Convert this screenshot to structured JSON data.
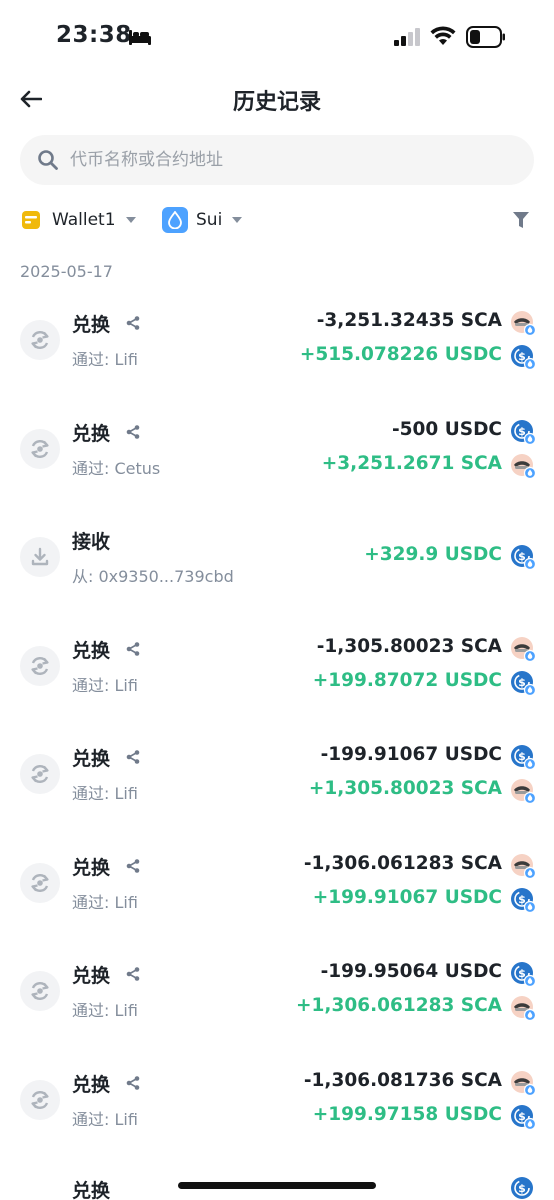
{
  "status_bar": {
    "time": "23:38"
  },
  "nav": {
    "title": "历史记录"
  },
  "search": {
    "placeholder": "代币名称或合约地址"
  },
  "filters": {
    "wallet": "Wallet1",
    "chain": "Sui"
  },
  "colors": {
    "positive": "#2ebd85",
    "negative": "#1e2329",
    "muted": "#848e9c",
    "wallet_yellow": "#f0b90b",
    "sui_blue": "#4da2ff",
    "usdc_blue": "#2775ca"
  },
  "date": "2025-05-17",
  "transactions": [
    {
      "type": "兑换",
      "sub": "通过: Lifi",
      "line1": "-3,251.32435 SCA",
      "line1_token": "SCA",
      "line2": "+515.078226 USDC",
      "line2_token": "USDC"
    },
    {
      "type": "兑换",
      "sub": "通过: Cetus",
      "line1": "-500 USDC",
      "line1_token": "USDC",
      "line2": "+3,251.2671 SCA",
      "line2_token": "SCA"
    },
    {
      "type": "接收",
      "sub": "从: 0x9350...739cbd",
      "line1": "+329.9 USDC",
      "line1_token": "USDC"
    },
    {
      "type": "兑换",
      "sub": "通过: Lifi",
      "line1": "-1,305.80023 SCA",
      "line1_token": "SCA",
      "line2": "+199.87072 USDC",
      "line2_token": "USDC"
    },
    {
      "type": "兑换",
      "sub": "通过: Lifi",
      "line1": "-199.91067 USDC",
      "line1_token": "USDC",
      "line2": "+1,305.80023 SCA",
      "line2_token": "SCA"
    },
    {
      "type": "兑换",
      "sub": "通过: Lifi",
      "line1": "-1,306.061283 SCA",
      "line1_token": "SCA",
      "line2": "+199.91067 USDC",
      "line2_token": "USDC"
    },
    {
      "type": "兑换",
      "sub": "通过: Lifi",
      "line1": "-199.95064 USDC",
      "line1_token": "USDC",
      "line2": "+1,306.061283 SCA",
      "line2_token": "SCA"
    },
    {
      "type": "兑换",
      "sub": "通过: Lifi",
      "line1": "-1,306.081736 SCA",
      "line1_token": "SCA",
      "line2": "+199.97158 USDC",
      "line2_token": "USDC"
    }
  ],
  "partial_row": {
    "type": "兑换"
  }
}
